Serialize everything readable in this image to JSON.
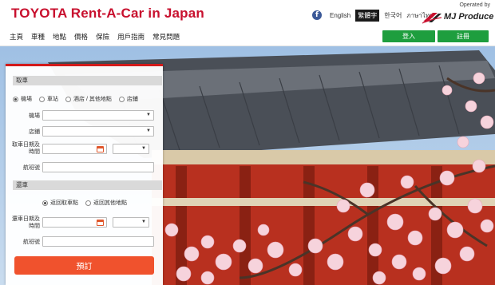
{
  "header": {
    "title": "TOYOTA Rent-A-Car in Japan",
    "languages": [
      {
        "label": "English",
        "active": false
      },
      {
        "label": "繁體字",
        "active": true
      },
      {
        "label": "한국어",
        "active": false
      },
      {
        "label": "ภาษาไทย",
        "active": false
      }
    ],
    "operated_by": "Operated by",
    "brand": "MJ Produce",
    "icons": {
      "facebook": "facebook-icon",
      "brand_logo": "mj-logo-icon"
    }
  },
  "nav": {
    "items": [
      "主頁",
      "車種",
      "地點",
      "價格",
      "保險",
      "用戶指南",
      "常見問題"
    ],
    "login": "登入",
    "register": "註冊"
  },
  "booking": {
    "pickup_section": "取車",
    "pickup_type_options": [
      {
        "label": "機場",
        "checked": true
      },
      {
        "label": "車站",
        "checked": false
      },
      {
        "label": "酒店 / 其他地點",
        "checked": false
      },
      {
        "label": "店鋪",
        "checked": false
      }
    ],
    "airport_label": "機場",
    "store_label": "店鋪",
    "pickup_datetime_label": "取車日期及時間",
    "flight_label": "航班號",
    "return_section": "還車",
    "return_options": [
      {
        "label": "返回取車點",
        "checked": true
      },
      {
        "label": "返回其他地點",
        "checked": false
      }
    ],
    "return_datetime_label": "還車日期及時間",
    "return_flight_label": "航班號",
    "submit": "預訂"
  },
  "colors": {
    "brand_red": "#c8102e",
    "green": "#1e9e3e",
    "submit": "#f0522d"
  }
}
